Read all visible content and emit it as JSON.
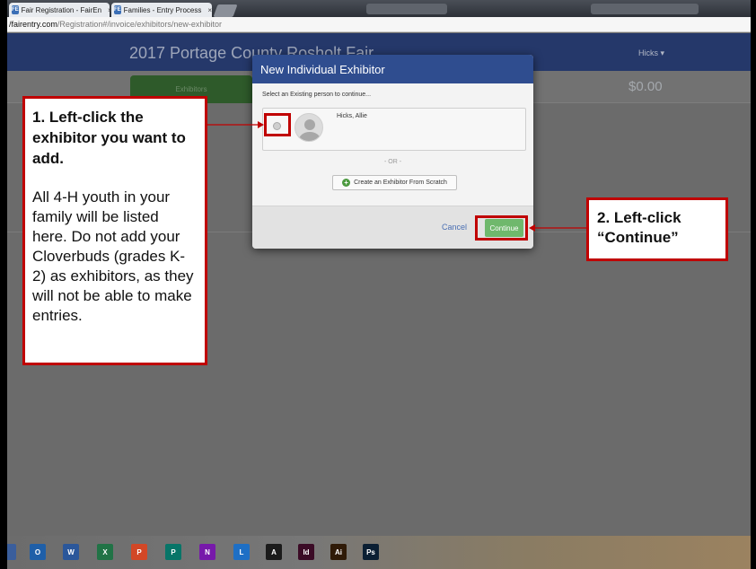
{
  "browser": {
    "tabs": [
      {
        "label": "Fair Registration - FairEn",
        "favicon": "FE"
      },
      {
        "label": "Families - Entry Process",
        "favicon": "FE"
      }
    ],
    "close_glyph": "×",
    "address_domain": "/fairentry.com",
    "address_path": "/Registration#/invoice/exhibitors/new-exhibitor"
  },
  "navbar": {
    "title": "2017 Portage County Rosholt Fair",
    "user_menu": "Hicks ▾"
  },
  "subbar": {
    "tab_exhibitors": "Exhibitors",
    "total": "$0.00"
  },
  "modal": {
    "title": "New Individual Exhibitor",
    "instruction": "Select an Existing person to continue...",
    "person_name": "Hicks, Allie",
    "or_text": "- OR -",
    "create_button": "Create an Exhibitor From Scratch",
    "cancel_label": "Cancel",
    "continue_label": "Continue"
  },
  "callouts": {
    "step1_title": "1. Left-click the exhibitor you want to add.",
    "step1_body": "All 4-H youth in your family will be listed here. Do not add your Cloverbuds (grades K-2) as exhibitors, as they will not be able to make entries.",
    "step2_title": "2. Left-click “Continue”"
  },
  "taskbar": {
    "icons": [
      {
        "name": "outlook-icon",
        "label": "O",
        "color": "#1f5fa8"
      },
      {
        "name": "word-icon",
        "label": "W",
        "color": "#2b579a"
      },
      {
        "name": "excel-icon",
        "label": "X",
        "color": "#217346"
      },
      {
        "name": "powerpoint-icon",
        "label": "P",
        "color": "#d24726"
      },
      {
        "name": "publisher-icon",
        "label": "P",
        "color": "#077568"
      },
      {
        "name": "onenote-icon",
        "label": "N",
        "color": "#7719aa"
      },
      {
        "name": "lync-icon",
        "label": "L",
        "color": "#1e6fc5"
      },
      {
        "name": "acrobat-icon",
        "label": "A",
        "color": "#1b1b1b"
      },
      {
        "name": "indesign-icon",
        "label": "Id",
        "color": "#3b0b26"
      },
      {
        "name": "illustrator-icon",
        "label": "Ai",
        "color": "#2f1a07"
      },
      {
        "name": "photoshop-icon",
        "label": "Ps",
        "color": "#0b1f33"
      }
    ]
  },
  "colors": {
    "highlight_red": "#c00000",
    "navbar_blue": "#25386a",
    "continue_green": "#6fb86c"
  }
}
